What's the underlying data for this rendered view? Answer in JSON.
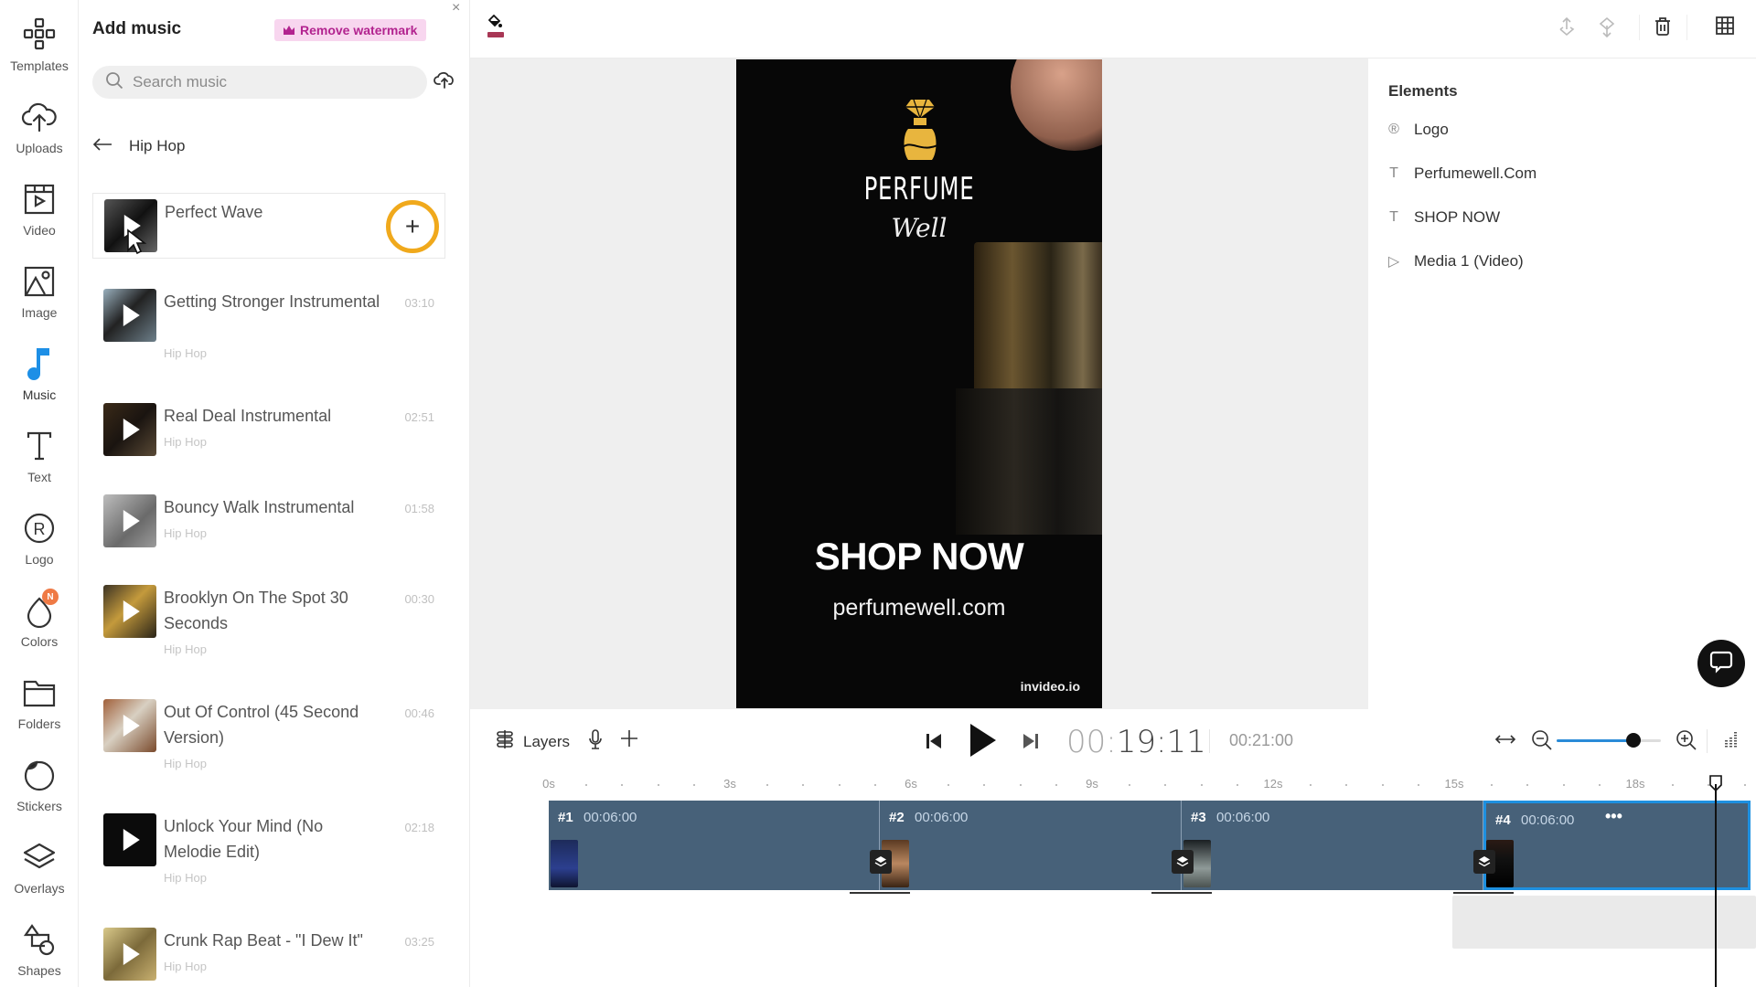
{
  "sidebar": {
    "items": [
      {
        "label": "Templates",
        "icon": "templates-icon"
      },
      {
        "label": "Uploads",
        "icon": "upload-cloud-icon"
      },
      {
        "label": "Video",
        "icon": "video-icon"
      },
      {
        "label": "Image",
        "icon": "image-icon"
      },
      {
        "label": "Music",
        "icon": "music-note-icon",
        "active": true
      },
      {
        "label": "Text",
        "icon": "text-icon"
      },
      {
        "label": "Logo",
        "icon": "registered-icon"
      },
      {
        "label": "Colors",
        "icon": "color-drop-icon",
        "badge": "N"
      },
      {
        "label": "Folders",
        "icon": "folder-icon"
      },
      {
        "label": "Stickers",
        "icon": "sticker-icon"
      },
      {
        "label": "Overlays",
        "icon": "overlays-icon"
      },
      {
        "label": "Shapes",
        "icon": "shapes-icon"
      }
    ]
  },
  "music_panel": {
    "title": "Add music",
    "remove_watermark": "Remove watermark",
    "close": "×",
    "search_placeholder": "Search music",
    "category": "Hip Hop",
    "tracks": [
      {
        "title": "Perfect Wave",
        "genre": "",
        "duration": "",
        "selected": true
      },
      {
        "title": "Getting Stronger Instrumental",
        "genre": "Hip Hop",
        "duration": "03:10"
      },
      {
        "title": "Real Deal Instrumental",
        "genre": "Hip Hop",
        "duration": "02:51"
      },
      {
        "title": "Bouncy Walk Instrumental",
        "genre": "Hip Hop",
        "duration": "01:58"
      },
      {
        "title": "Brooklyn On The Spot 30 Seconds",
        "genre": "Hip Hop",
        "duration": "00:30"
      },
      {
        "title": "Out Of Control (45 Second Version)",
        "genre": "Hip Hop",
        "duration": "00:46"
      },
      {
        "title": "Unlock Your Mind (No Melodie Edit)",
        "genre": "Hip Hop",
        "duration": "02:18"
      },
      {
        "title": "Crunk Rap Beat - \"I Dew It\"",
        "genre": "Hip Hop",
        "duration": "03:25"
      }
    ],
    "add_label": "+"
  },
  "toolbar": {
    "fill_color": "#a83755"
  },
  "canvas": {
    "brand_line1": "PERFUME",
    "brand_line2": "Well",
    "headline": "SHOP NOW",
    "url": "perfumewell.com",
    "watermark": "invideo.io"
  },
  "elements_panel": {
    "title": "Elements",
    "items": [
      {
        "label": "Logo",
        "icon": "®"
      },
      {
        "label": "Perfumewell.Com",
        "icon": "T"
      },
      {
        "label": "SHOP NOW",
        "icon": "T"
      },
      {
        "label": "Media 1 (Video)",
        "icon": "▷"
      }
    ]
  },
  "controls": {
    "layers_label": "Layers",
    "current_time_dim": "00:",
    "current_time": "19:11",
    "total_time": "00:21:00",
    "zoom_level": 0.74
  },
  "timeline": {
    "ruler": [
      "0s",
      "3s",
      "6s",
      "9s",
      "12s",
      "15s",
      "18s"
    ],
    "clips": [
      {
        "num": "#1",
        "duration": "00:06:00"
      },
      {
        "num": "#2",
        "duration": "00:06:00"
      },
      {
        "num": "#3",
        "duration": "00:06:00"
      },
      {
        "num": "#4",
        "duration": "00:06:00",
        "selected": true,
        "more": "•••"
      }
    ]
  }
}
